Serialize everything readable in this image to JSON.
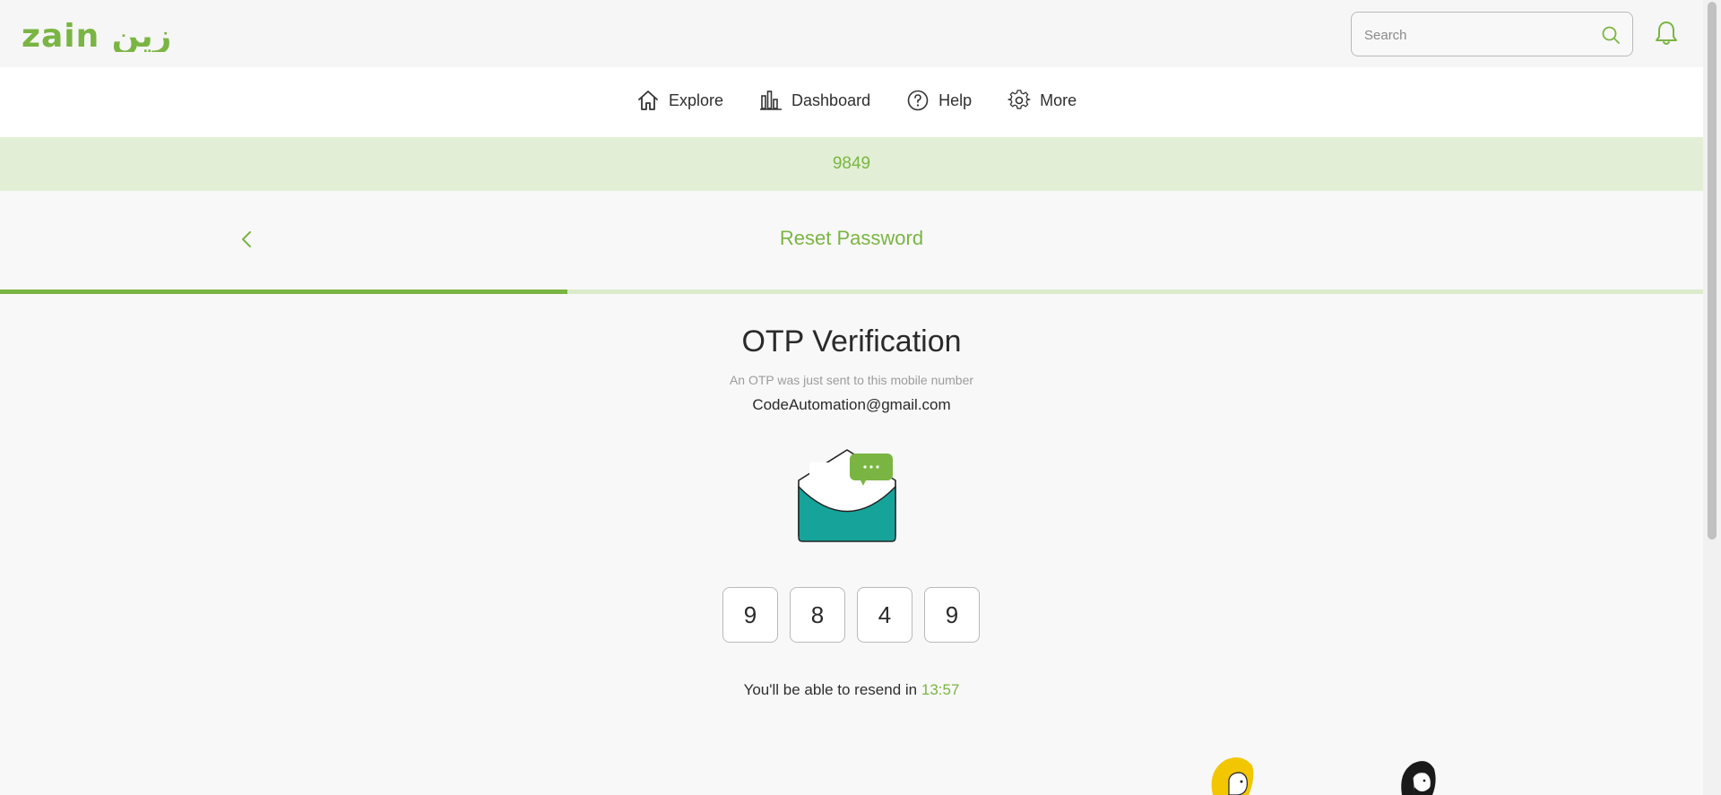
{
  "header": {
    "logo_text": "zain زين",
    "search_placeholder": "Search"
  },
  "nav": {
    "items": [
      {
        "label": "Explore",
        "icon": "home-icon"
      },
      {
        "label": "Dashboard",
        "icon": "bar-chart-icon"
      },
      {
        "label": "Help",
        "icon": "help-circle-icon"
      },
      {
        "label": "More",
        "icon": "gear-icon"
      }
    ]
  },
  "banner": {
    "text": "9849"
  },
  "page": {
    "title": "Reset Password",
    "progress": 0.333
  },
  "otp": {
    "heading": "OTP Verification",
    "subtext": "An OTP was just sent to this mobile number",
    "email": "CodeAutomation@gmail.com",
    "digits": [
      "9",
      "8",
      "4",
      "9"
    ],
    "resend_text": "You'll be able to resend in",
    "timer": "13:57"
  },
  "colors": {
    "brand": "#7ab543",
    "banner_bg": "#e2efd6",
    "envelope": "#16a39a"
  }
}
